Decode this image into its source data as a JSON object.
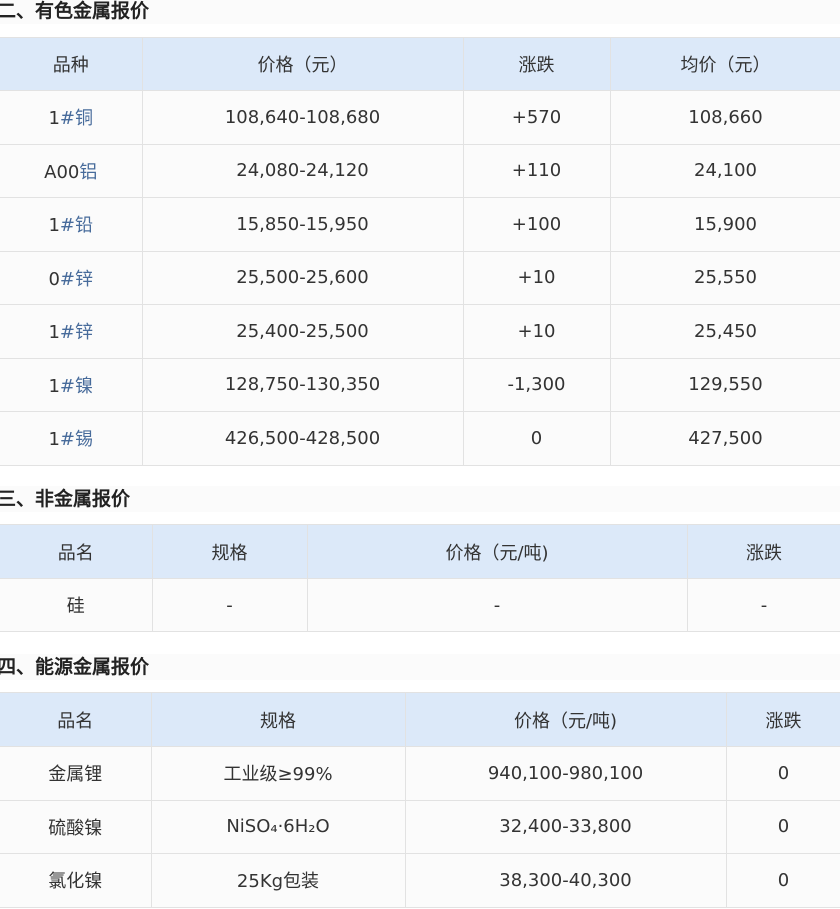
{
  "section1": {
    "title": "二、有色金属报价",
    "headers": [
      "品种",
      "价格（元）",
      "涨跌",
      "均价（元）"
    ],
    "rows": [
      {
        "prefix": "1",
        "link": "#铜",
        "price": "108,640-108,680",
        "change": "+570",
        "avg": "108,660"
      },
      {
        "prefix": "A00",
        "link": "铝",
        "price": "24,080-24,120",
        "change": "+110",
        "avg": "24,100"
      },
      {
        "prefix": "1",
        "link": "#铅",
        "price": "15,850-15,950",
        "change": "+100",
        "avg": "15,900"
      },
      {
        "prefix": "0",
        "link": "#锌",
        "price": "25,500-25,600",
        "change": "+10",
        "avg": "25,550"
      },
      {
        "prefix": "1",
        "link": "#锌",
        "price": "25,400-25,500",
        "change": "+10",
        "avg": "25,450"
      },
      {
        "prefix": "1",
        "link": "#镍",
        "price": "128,750-130,350",
        "change": "-1,300",
        "avg": "129,550"
      },
      {
        "prefix": "1",
        "link": "#锡",
        "price": "426,500-428,500",
        "change": "0",
        "avg": "427,500"
      }
    ]
  },
  "section2": {
    "title": "三、非金属报价",
    "headers": [
      "品名",
      "规格",
      "价格（元/吨)",
      "涨跌"
    ],
    "rows": [
      {
        "name": "硅",
        "spec": "-",
        "price": "-",
        "change": "-"
      }
    ]
  },
  "section3": {
    "title": "四、能源金属报价",
    "headers": [
      "品名",
      "规格",
      "价格（元/吨)",
      "涨跌"
    ],
    "rows": [
      {
        "name": "金属锂",
        "spec": "工业级≥99%",
        "price": "940,100-980,100",
        "change": "0"
      },
      {
        "name": "硫酸镍",
        "spec": "NiSO₄·6H₂O",
        "price": "32,400-33,800",
        "change": "0"
      },
      {
        "name": "氯化镍",
        "spec": "25Kg包装",
        "price": "38,300-40,300",
        "change": "0"
      }
    ]
  }
}
